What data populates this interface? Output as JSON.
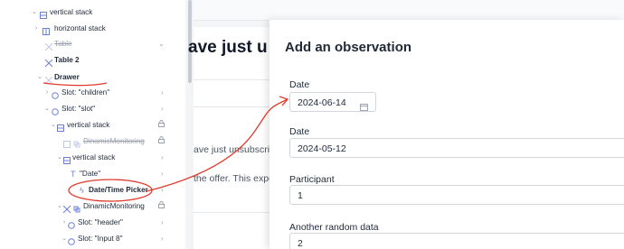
{
  "tree": {
    "items": [
      {
        "label": "vertical stack",
        "icon": "stack-icon",
        "disabled": false,
        "bold": false
      },
      {
        "label": "horizontal stack",
        "icon": "stack-icon",
        "disabled": false,
        "bold": false
      },
      {
        "label": "Table",
        "icon": "table-icon",
        "disabled": true,
        "bold": false
      },
      {
        "label": "Table 2",
        "icon": "table-icon",
        "disabled": false,
        "bold": true
      },
      {
        "label": "Drawer",
        "icon": "drawer-icon",
        "disabled": false,
        "bold": true
      },
      {
        "label": "Slot: \"children\"",
        "icon": "slot-icon",
        "disabled": false,
        "bold": false
      },
      {
        "label": "Slot: \"slot\"",
        "icon": "slot-icon",
        "disabled": false,
        "bold": false
      },
      {
        "label": "vertical stack",
        "icon": "stack-icon",
        "disabled": false,
        "bold": false
      },
      {
        "label": "DinamicMonitoring",
        "icon": "component-icon",
        "disabled": true,
        "bold": false
      },
      {
        "label": "vertical stack",
        "icon": "stack-icon",
        "disabled": false,
        "bold": false
      },
      {
        "label": "\"Date\"",
        "icon": "text-icon",
        "disabled": false,
        "bold": false
      },
      {
        "label": "Date/Time Picker",
        "icon": "lightning-icon",
        "disabled": false,
        "bold": true
      },
      {
        "label": "DinamicMonitoring",
        "icon": "component-icon",
        "disabled": false,
        "bold": false
      },
      {
        "label": "Slot: \"header\"",
        "icon": "slot-icon",
        "disabled": false,
        "bold": false
      },
      {
        "label": "Slot: \"Input 8\"",
        "icon": "slot-icon",
        "disabled": false,
        "bold": false
      }
    ]
  },
  "background": {
    "title": "ave just u",
    "text1": "ave just unsubscrib",
    "text2": "the offer. This expe"
  },
  "drawer": {
    "title": "Add an observation",
    "fields": [
      {
        "label": "Date",
        "value": "2024-06-14",
        "icon": "calendar-icon"
      },
      {
        "label": "Date",
        "value": "2024-05-12"
      },
      {
        "label": "Participant",
        "value": "1"
      },
      {
        "label": "Another random data",
        "value": "2"
      }
    ]
  },
  "colors": {
    "accent": "#e0392b",
    "icon": "#6b7fd7"
  }
}
